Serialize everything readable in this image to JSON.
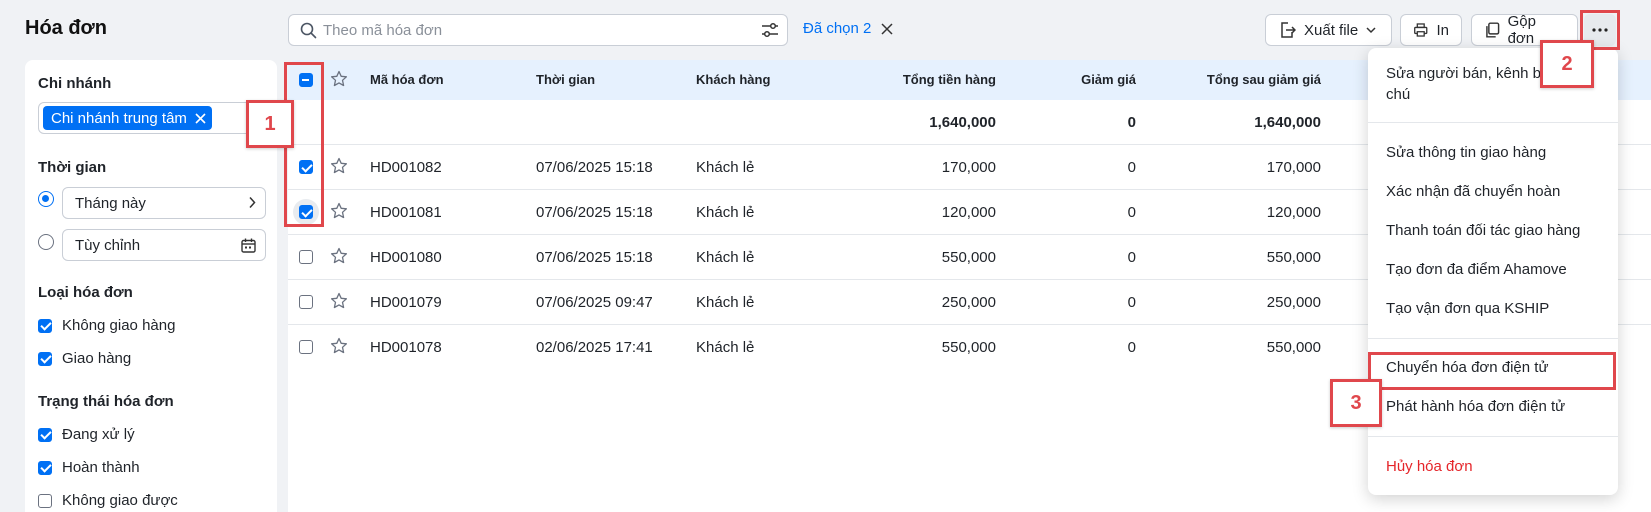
{
  "header": {
    "title": "Hóa đơn",
    "search_placeholder": "Theo mã hóa đơn",
    "selected_label": "Đã chọn 2",
    "export_label": "Xuất file",
    "print_label": "In",
    "merge_label": "Gộp đơn",
    "more_label": "···"
  },
  "sidebar": {
    "branch_title": "Chi nhánh",
    "branch_chip": "Chi nhánh trung tâm",
    "time_title": "Thời gian",
    "time_this_month": "Tháng này",
    "time_custom": "Tùy chỉnh",
    "invoice_type_title": "Loại hóa đơn",
    "invoice_types": [
      {
        "label": "Không giao hàng",
        "checked": true
      },
      {
        "label": "Giao hàng",
        "checked": true
      }
    ],
    "status_title": "Trạng thái hóa đơn",
    "statuses": [
      {
        "label": "Đang xử lý",
        "checked": true
      },
      {
        "label": "Hoàn thành",
        "checked": true
      },
      {
        "label": "Không giao được",
        "checked": false
      }
    ]
  },
  "table": {
    "columns": [
      "Mã hóa đơn",
      "Thời gian",
      "Khách hàng",
      "Tổng tiền hàng",
      "Giảm giá",
      "Tổng sau giảm giá"
    ],
    "totals": {
      "total": "1,640,000",
      "discount": "0",
      "after": "1,640,000"
    },
    "rows": [
      {
        "id": "HD001082",
        "time": "07/06/2025 15:18",
        "customer": "Khách lẻ",
        "total": "170,000",
        "discount": "0",
        "after": "170,000",
        "checked": true
      },
      {
        "id": "HD001081",
        "time": "07/06/2025 15:18",
        "customer": "Khách lẻ",
        "total": "120,000",
        "discount": "0",
        "after": "120,000",
        "checked": true
      },
      {
        "id": "HD001080",
        "time": "07/06/2025 15:18",
        "customer": "Khách lẻ",
        "total": "550,000",
        "discount": "0",
        "after": "550,000",
        "checked": false
      },
      {
        "id": "HD001079",
        "time": "07/06/2025 09:47",
        "customer": "Khách lẻ",
        "total": "250,000",
        "discount": "0",
        "after": "250,000",
        "checked": false
      },
      {
        "id": "HD001078",
        "time": "02/06/2025 17:41",
        "customer": "Khách lẻ",
        "total": "550,000",
        "discount": "0",
        "after": "550,000",
        "checked": false
      }
    ]
  },
  "menu": {
    "item_edit_seller_1": "Sửa người bán, kênh bá",
    "item_edit_seller_2": "chú",
    "item_shipping_info": "Sửa thông tin giao hàng",
    "item_confirm_return": "Xác nhận đã chuyển hoàn",
    "item_pay_partner": "Thanh toán đối tác giao hàng",
    "item_ahamove": "Tạo đơn đa điểm Ahamove",
    "item_kship": "Tạo vận đơn qua KSHIP",
    "item_convert_einvoice": "Chuyển hóa đơn điện tử",
    "item_issue_einvoice": "Phát hành hóa đơn điện tử",
    "item_cancel": "Hủy hóa đơn"
  },
  "annotations": {
    "one": "1",
    "two": "2",
    "three": "3"
  },
  "colors": {
    "accent": "#0070f4",
    "header_bg": "#e6f1fe",
    "annotation": "#e0474c",
    "danger": "#e5252a"
  }
}
